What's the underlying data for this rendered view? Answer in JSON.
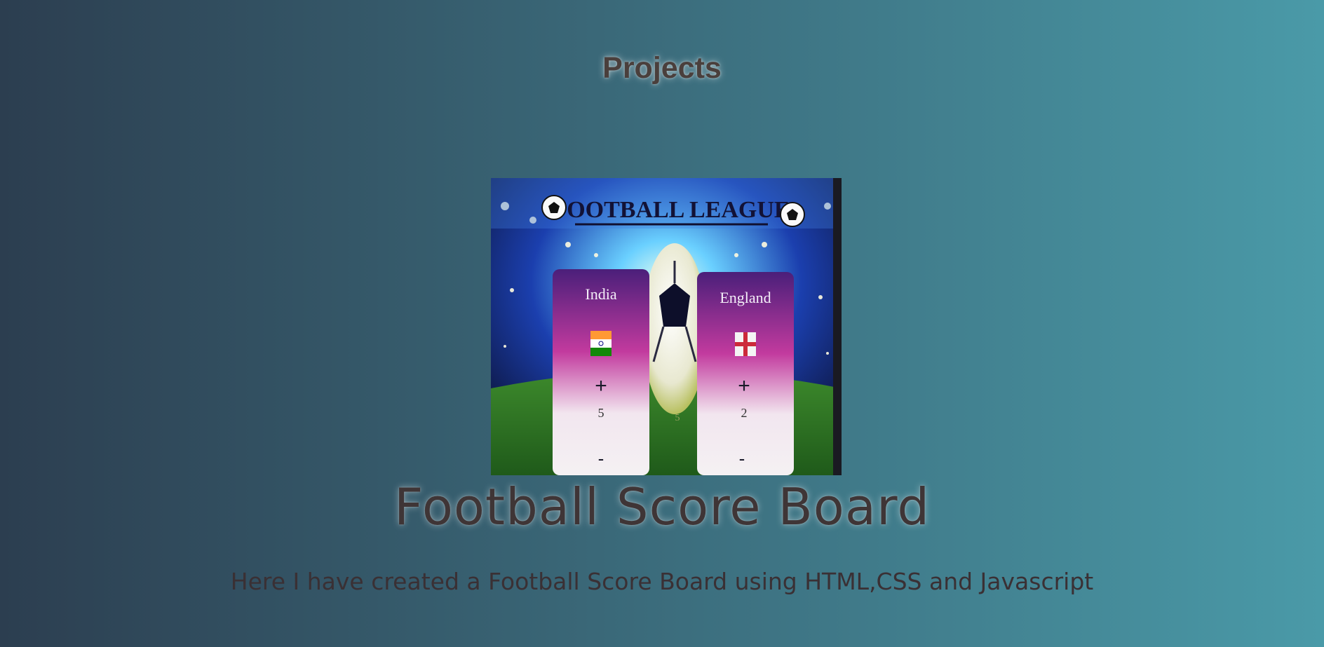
{
  "page": {
    "heading": "Projects"
  },
  "project": {
    "title": "Football Score Board",
    "description": "Here I have created a Football Score Board using HTML,CSS and Javascript",
    "screenshot": {
      "banner": "FOOTBALL LEAGUE",
      "team_left": {
        "name": "India",
        "score": "5",
        "plus": "+",
        "minus": "-"
      },
      "team_right": {
        "name": "England",
        "score": "2",
        "plus": "+",
        "minus": "-"
      },
      "center_score": "5"
    }
  },
  "colors": {
    "bg_start": "#2c3e50",
    "bg_end": "#4a9aa8",
    "heading_text": "#4a3f3c",
    "title_text": "#3f3536",
    "card_top": "#4a1f7a",
    "card_mid": "#c23a9e"
  }
}
